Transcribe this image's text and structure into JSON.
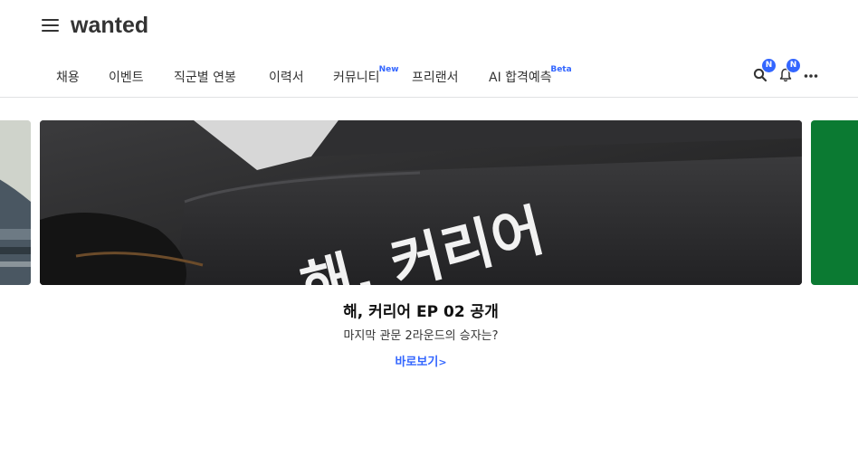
{
  "app": {
    "logo": "wanted"
  },
  "nav": {
    "items": [
      {
        "label": "채용"
      },
      {
        "label": "이벤트"
      },
      {
        "label": "직군별 연봉"
      },
      {
        "label": "이력서"
      },
      {
        "label": "커뮤니티",
        "sup": "New"
      },
      {
        "label": "프리랜서"
      },
      {
        "label": "AI 합격예측",
        "sup": "Beta"
      }
    ],
    "search_badge": "N",
    "notification_badge": "N"
  },
  "banner": {
    "image_text": "해, 커리어",
    "title": "해, 커리어 EP 02 공개",
    "subtitle": "마지막 관문 2라운드의 승자는?",
    "link_label": "바로보기",
    "link_arrow": ">"
  },
  "colors": {
    "accent": "#3366ff",
    "right_slide": "#0b7a32"
  }
}
